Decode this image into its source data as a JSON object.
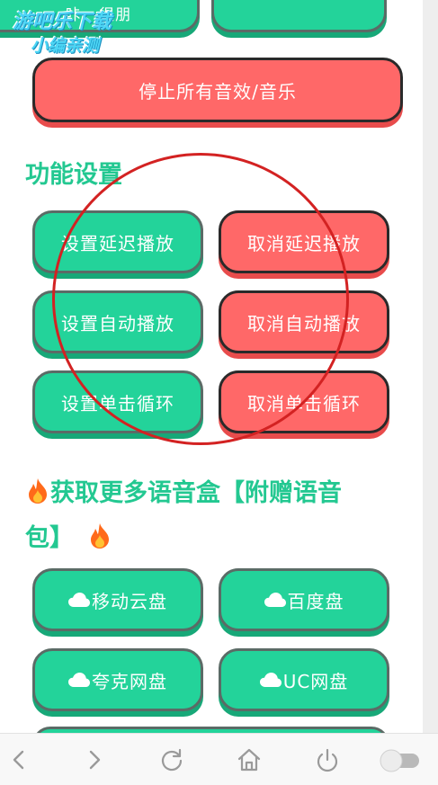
{
  "watermark": {
    "line1": "游吧乐下载",
    "line2": "小编亲测"
  },
  "top_buttons": {
    "left_partial": "咔 · 很朋",
    "right_partial": ""
  },
  "stop_all_label": "停止所有音效/音乐",
  "function_settings": {
    "title": "功能设置",
    "buttons": [
      {
        "label": "设置延迟播放",
        "color": "green"
      },
      {
        "label": "取消延迟播放",
        "color": "red"
      },
      {
        "label": "设置自动播放",
        "color": "green"
      },
      {
        "label": "取消自动播放",
        "color": "red"
      },
      {
        "label": "设置单击循环",
        "color": "green"
      },
      {
        "label": "取消单击循环",
        "color": "red"
      }
    ]
  },
  "more_boxes": {
    "title_line1": "获取更多语音盒【附赠语音",
    "title_line2": "包】",
    "buttons": [
      {
        "label": "移动云盘",
        "icon": "cloud-icon"
      },
      {
        "label": "百度盘",
        "icon": "cloud-icon"
      },
      {
        "label": "夸克网盘",
        "icon": "cloud-icon"
      },
      {
        "label": "UC网盘",
        "icon": "cloud-icon"
      }
    ]
  },
  "navbar": {
    "items": [
      "back-icon",
      "forward-icon",
      "refresh-icon",
      "home-icon",
      "power-icon",
      "toggle-switch"
    ]
  },
  "colors": {
    "green": "#23d39a",
    "red": "#ff6868",
    "title": "#23c891",
    "annotation": "#d32222"
  }
}
